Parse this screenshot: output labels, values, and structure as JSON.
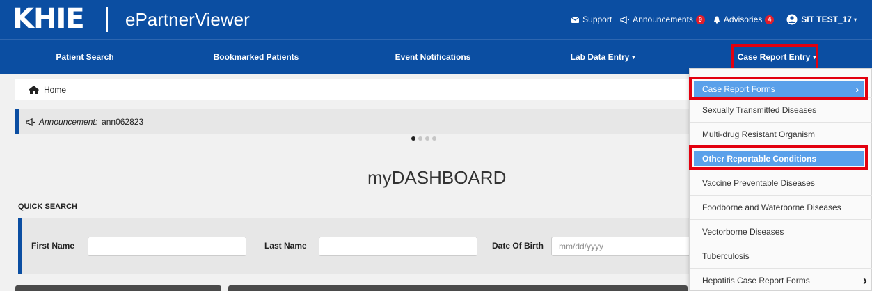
{
  "header": {
    "logo": "KHIE",
    "app_name": "ePartnerViewer",
    "links": [
      {
        "label": "Support",
        "icon": "envelope-icon"
      },
      {
        "label": "Announcements",
        "icon": "megaphone-icon",
        "badge": "9"
      },
      {
        "label": "Advisories",
        "icon": "bell-icon",
        "badge": "4"
      },
      {
        "label": "SIT TEST_17",
        "icon": "user-circle-icon"
      }
    ]
  },
  "nav": {
    "items": [
      {
        "label": "Patient Search"
      },
      {
        "label": "Bookmarked Patients"
      },
      {
        "label": "Event Notifications"
      },
      {
        "label": "Lab Data Entry",
        "caret": "▾"
      },
      {
        "label": "Case Report Entry",
        "caret": "▾"
      }
    ]
  },
  "breadcrumb": {
    "home_label": "Home"
  },
  "announcement": {
    "label": "Announcement:",
    "text": "ann062823"
  },
  "dashboard": {
    "title": "myDASHBOARD"
  },
  "quick_search": {
    "title": "QUICK SEARCH",
    "first_name_label": "First Name",
    "last_name_label": "Last Name",
    "dob_label": "Date Of Birth",
    "first_name_value": "",
    "last_name_value": "",
    "dob_placeholder": "mm/dd/yyyy"
  },
  "dropdown": {
    "items": [
      {
        "label": "Case Report Forms",
        "chevron": "›"
      },
      {
        "label": "Sexually Transmitted Diseases"
      },
      {
        "label": "Multi-drug Resistant Organism"
      },
      {
        "label": "Other Reportable Conditions"
      },
      {
        "label": "Vaccine Preventable Diseases"
      },
      {
        "label": "Foodborne and Waterborne Diseases"
      },
      {
        "label": "Vectorborne Diseases"
      },
      {
        "label": "Tuberculosis"
      },
      {
        "label": "Hepatitis Case Report Forms",
        "chevron": "›"
      }
    ]
  },
  "colors": {
    "brand": "#0b4ea2",
    "highlight": "#e3000f",
    "selected": "#5aa0ea",
    "badge": "#e11d2a"
  }
}
